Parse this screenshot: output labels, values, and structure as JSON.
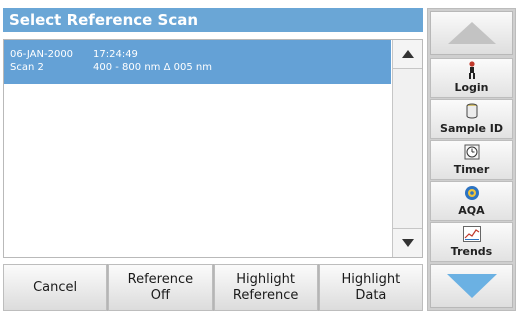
{
  "title": "Select Reference Scan",
  "list": {
    "rows": [
      {
        "date": "06-JAN-2000",
        "time": "17:24:49",
        "name": "Scan 2",
        "range": "400 - 800 nm Δ 005 nm"
      }
    ]
  },
  "bottom_buttons": {
    "cancel": "Cancel",
    "reference_off": "Reference\nOff",
    "highlight_reference": "Highlight\nReference",
    "highlight_data": "Highlight\nData"
  },
  "sidebar": {
    "login": "Login",
    "sample_id": "Sample ID",
    "timer": "Timer",
    "aqa": "AQA",
    "trends": "Trends"
  },
  "colors": {
    "title_bg": "#6aa6d6",
    "selection_bg": "#64a1d6",
    "nav_arrow": "#6bb1e3",
    "scroll_arrow": "#333333"
  },
  "icons": {
    "up": "triangle-up",
    "down": "triangle-down",
    "login": "person-icon",
    "sample_id": "cylinder-icon",
    "timer": "clock-icon",
    "aqa": "sphere-icon",
    "trends": "chart-icon"
  }
}
